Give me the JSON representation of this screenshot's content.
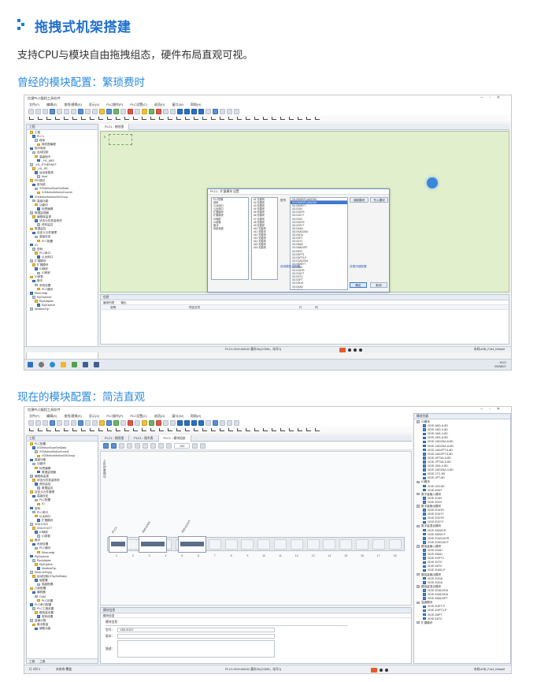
{
  "heading": {
    "title": "拖拽式机架搭建",
    "intro": "支持CPU与模块自由拖拽组态，硬件布局直观可视。"
  },
  "captions": {
    "before": "曾经的模块配置：繁琐费时",
    "after": "现在的模块配置：简洁直观"
  },
  "colors": {
    "accent": "#1f6fcf",
    "caption": "#2a8ae0",
    "canvas_green": "#e2efcd"
  },
  "old_ui": {
    "window_title": "信捷PLC编程工具软件",
    "menu": [
      "文件(F)",
      "编辑(E)",
      "查找\\替换(S)",
      "显示(V)",
      "PLC操作(P)",
      "PLC设置(C)",
      "选项(O)",
      "窗口(W)",
      "帮助(H)"
    ],
    "tab": "PLC1 - 梯形图",
    "project_panel_title": "工程",
    "project_tree": [
      "工程",
      "PLC1",
      "程序",
      "梯形图编程",
      "指令程序",
      "运动控制",
      "高级指令",
      "_H1_ABS",
      "_H1_ETHERNET",
      "_H1_RS",
      "运动参数表",
      "Mod",
      "PID调试",
      "新功能",
      "XGMotionScanSetData",
      "XGMotionMotionCoordd",
      "XGMotionMotionCtrlGroup",
      "高级功能",
      "功能块",
      "标签编辑",
      "数据监视器",
      "编程库监视",
      "状态元件批量修改",
      "资料监控",
      "数据监控",
      "自定义元件管理",
      "高级设定",
      "PLC配置",
      "IO",
      "密码",
      "PLC串口",
      "以太网口",
      "扩展模块",
      "扩展模块",
      "IO映射",
      "IO映射",
      "IO参数",
      "脉冲",
      "系统设置",
      "PLC通讯",
      "Ethernetip",
      "EipScanner",
      "EipAdapter",
      "EipExplicit",
      "ModbusTcp"
    ],
    "dialog": {
      "title": "PLC1 - 扩展模块 设置",
      "config_tree": [
        "PLC配置",
        "密码",
        "以太网口",
        "以太网口",
        "扩展模块",
        "扩展模块",
        "IO映射",
        "IO参数",
        "脉冲",
        "系统设置"
      ],
      "slot_list": [
        "#1 无模块",
        "#2 无模块",
        "#3 无模块",
        "#4 无模块",
        "#5 无模块",
        "#6 无模块",
        "#7 无模块",
        "#8 无模块",
        "#9 无模块",
        "#10 无模块",
        "#11 无模块",
        "#12 无模块",
        "#13 无模块",
        "#14 无模块",
        "#15 无模块",
        "#16 无模块"
      ],
      "model_label": "型号",
      "selected_model": "XD-E8X8YR-4AD2DA",
      "model_options": [
        "XD-E8X8YR-4AD2DA",
        "XD-E8X8YT",
        "XD-E16X",
        "XD-E16YR",
        "XD-E16YT",
        "XD-E32X",
        "XD-E32YR",
        "XD-E32YT",
        "XD-E4AD",
        "XD-E4AD2DA",
        "XD-E4DA",
        "XD-E4PT",
        "XD-E4TC",
        "XD-E8AD",
        "XD-E8AD4PT",
        "XD-E8TC",
        "XD-E4PT3",
        "XD-E4PT3-P",
        "XD-E2AD2DA",
        "XD-E8X8YT",
        "XD-E16X",
        "XD-E16YR",
        "XD-E16YT",
        "XD-E4TC",
        "XD-E4PT",
        "XD-E4DA",
        "XD-E4AD",
        "XD-E8AD",
        "XD-E8TC",
        "XD-E16X",
        "XD-E32X",
        "XD-E32YR",
        "XD-E32YT",
        "XD-E4PT3",
        "XD-E8AD4PT",
        "XD-E2AD2DA",
        "XD-E4AD2DA",
        "XD-E4DA"
      ],
      "btn_read": "读取模块",
      "btn_write": "写入模块",
      "link_ai_config": "使用模拟量配置",
      "link_detail": "查看详细配置",
      "btn_ok": "确定",
      "btn_cancel": "取消"
    },
    "info_panel_title": "信息",
    "info_tabs": [
      "编译列表",
      "输出"
    ],
    "info_columns": [
      "说明",
      "项目文件",
      "行",
      "列"
    ],
    "status": {
      "center": "PLC1:XDH-60A32  通讯Ok(COM4，站号1)",
      "right": "本机USB_Fnet_Default"
    },
    "taskbar_time": "15:01",
    "taskbar_date": "2025/8/27"
  },
  "new_ui": {
    "window_title": "信捷PLC编程工具软件",
    "menu": [
      "文件(F)",
      "编辑(E)",
      "查找\\替换(S)",
      "显示(V)",
      "PLC操作(P)",
      "PLC设置(C)",
      "选项(O)",
      "窗口(W)",
      "帮助(H)"
    ],
    "tabs": [
      "PLC1 - 梯形图",
      "PLC1 - 指令表",
      "PLC1 - 模块组态"
    ],
    "zoom": "100",
    "project_panel_title": "工程",
    "project_tree": [
      "PLC配置",
      "XGMotionScanSetData",
      "XGMotionMotionCoordi",
      "XGMotionMotionCtrlGroup",
      "高级功能",
      "功能块",
      "标签编辑",
      "数据监视器",
      "编程库监视",
      "状态元件批量修改",
      "资料监控",
      "数据监控",
      "自定义元件管理",
      "高级设定",
      "PLC配置",
      "IO",
      "密码",
      "PLC串口",
      "以太网口",
      "扩展模块",
      "XD6-E32X",
      "XD6-E16YT",
      "IO映射",
      "IO参数",
      "脉冲",
      "系统设置",
      "PLC通讯",
      "Ethernetip",
      "EipScanner",
      "EipAdapter",
      "EipExplicit",
      "ModbusTcp",
      "EthernetTcpIp",
      "运动控制(XTcpSetData)",
      "轴配置",
      "轴组配置",
      "凸轮配置",
      "编码器",
      "CAM",
      "PLC设置",
      "PLC串口配置",
      "PLC工程设置",
      "模拟量设置",
      "密码设置",
      "高速计数",
      "脉冲数量",
      "辅助功能"
    ],
    "panel_tabs": [
      "工程",
      "工具"
    ],
    "rack": {
      "side_label": "主机配置模块",
      "modules": [
        "PLC1",
        "XD6-E32X",
        "XD6-E16YT"
      ],
      "slots": [
        "1",
        "2",
        "3",
        "4",
        "5",
        "6",
        "7",
        "8",
        "9",
        "10",
        "11",
        "12",
        "13",
        "14",
        "15",
        "16",
        "17",
        "18"
      ]
    },
    "props": {
      "panel_title": "模块信息",
      "tabs": [
        "模块信息"
      ],
      "heading": "模块信息",
      "model_label": "型号：",
      "model_value": "XD6-E32X",
      "version_label": "版本：",
      "desc_label": "描述："
    },
    "module_list": {
      "title": "模块列表",
      "groups": [
        {
          "name": "IO模块",
          "items": [
            "XD/E-8AD-A-8D",
            "XD/E-4AD-V-8D",
            "XD/E-4DA-V-8D",
            "XD/E-4DA-A-8D",
            "XD/E-2AD2DA-8-8D",
            "XD/E-2AD2DA-A-8D",
            "XD/E-2AD2PT-5-8D",
            "XD/E-2AD2PT-5-8D",
            "XD/E-4PT3A-5-8D",
            "XD/E-2PT3A-5-8D",
            "XD/E-4DA-V-8D",
            "XD/E-2AD2DA-V-8D",
            "XD/E-1TC-8D",
            "XD/E-4PT-8D"
          ]
        },
        {
          "name": "IO模块",
          "items": [
            "XD/E-32X-8D",
            "XD/E-8X8Y"
          ]
        },
        {
          "name": "数字量输入模块",
          "items": [
            "XD/E-E16X",
            "XD/E-E32X"
          ]
        },
        {
          "name": "数字量输出模块",
          "items": [
            "XD/E-E16YR",
            "XD/E-E16YT",
            "XD/E-E32YR",
            "XD/E-E32YT"
          ]
        },
        {
          "name": "数字量混合模块",
          "items": [
            "XD/E-E8X8YR",
            "XD/E-E8X8YT",
            "XD/E-E16X16YR",
            "XD/E-E16X16YT"
          ]
        },
        {
          "name": "模拟量输入模块",
          "items": [
            "XD/E-E4AD",
            "XD/E-E8AD",
            "XD/E-E4PT3",
            "XD/E-E4TC",
            "XD/E-E8TC",
            "XD/E-E4AD-P"
          ]
        },
        {
          "name": "模拟量输出模块",
          "items": [
            "XD/E-E2DA",
            "XD/E-E4DA"
          ]
        },
        {
          "name": "模拟量混合模块",
          "items": [
            "XD/E-E2AD2DA",
            "XD/E-E4AD2DA",
            "XD/E-E8AD4PT"
          ]
        },
        {
          "name": "温度模块",
          "items": [
            "XD/E-E4PT-P",
            "XD/E-E4PT3-P",
            "XD/E-E8PT",
            "XD/E-E8TC"
          ]
        },
        {
          "name": "扩展模块",
          "items": []
        }
      ]
    },
    "status": {
      "left": "行 0列 0",
      "left2": "未修改 覆盖",
      "center": "PLC1:XDH-60A32  通讯Ok(COM4，站号1)",
      "right": "本机USB_Fnet_Default"
    }
  }
}
